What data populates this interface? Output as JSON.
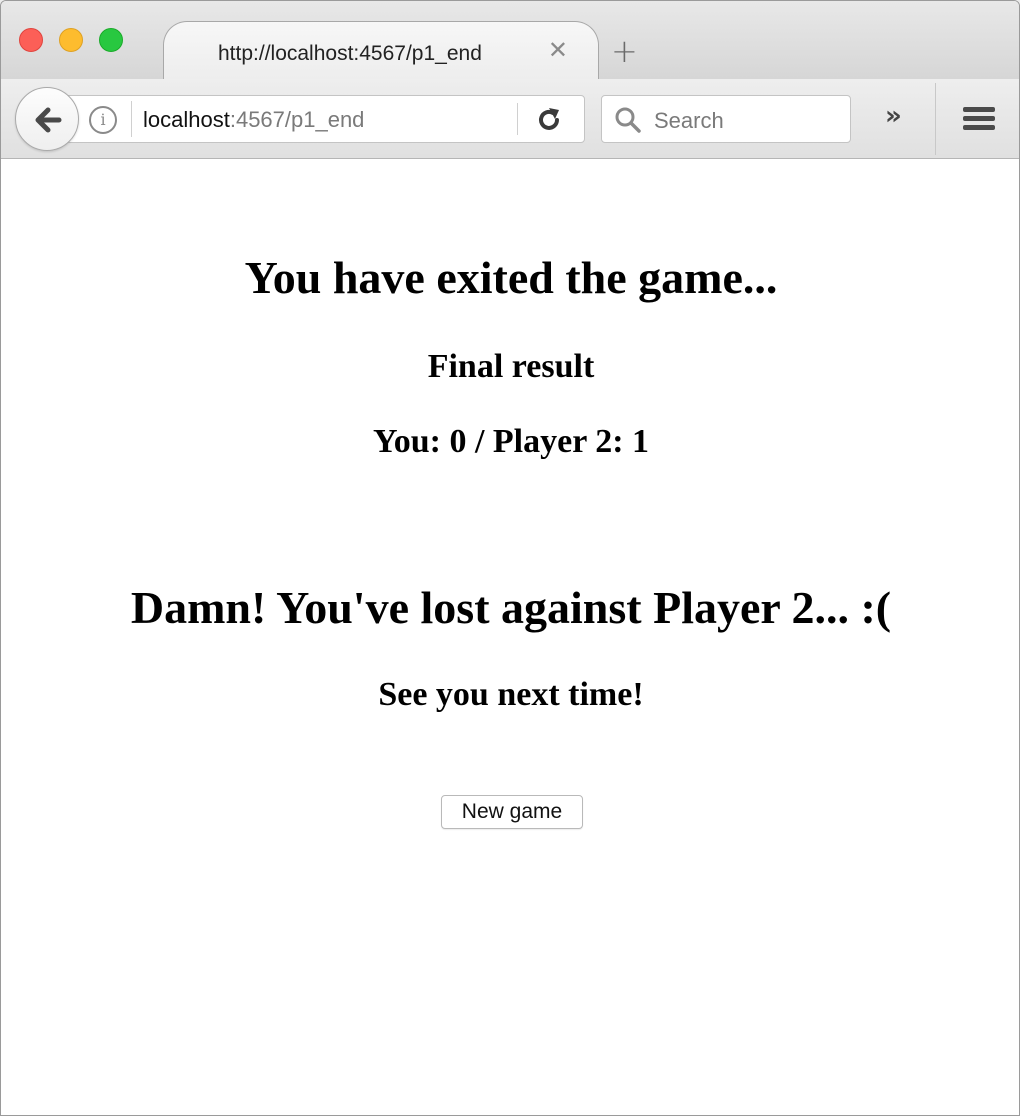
{
  "browser": {
    "tab_title": "http://localhost:4567/p1_end",
    "url_host": "localhost",
    "url_path": ":4567/p1_end",
    "search_placeholder": "Search",
    "icons": {
      "tab_close": "close-icon",
      "new_tab": "plus-icon",
      "back": "arrow-left-icon",
      "info": "info-icon",
      "reload": "reload-icon",
      "search": "search-icon",
      "overflow": "chevron-double-right-icon",
      "menu": "hamburger-menu-icon"
    }
  },
  "page": {
    "heading_exited": "You have exited the game...",
    "final_result_label": "Final result",
    "score_line": "You: 0 / Player 2: 1",
    "outcome_message": "Damn! You've lost against Player 2... :(",
    "farewell": "See you next time!",
    "new_game_button": "New game"
  }
}
